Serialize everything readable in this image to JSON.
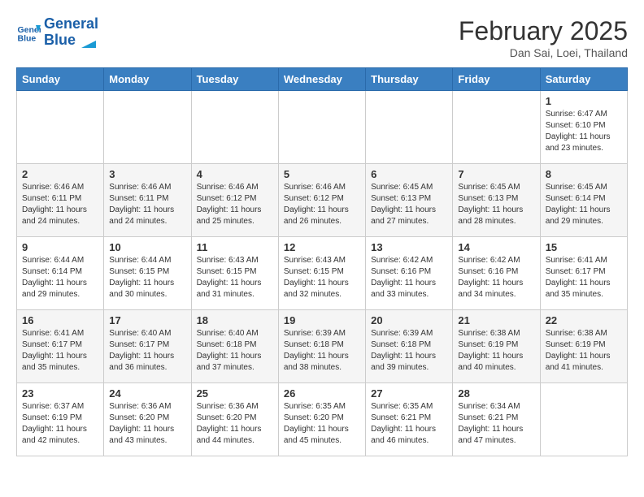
{
  "header": {
    "logo_line1": "General",
    "logo_line2": "Blue",
    "month": "February 2025",
    "location": "Dan Sai, Loei, Thailand"
  },
  "weekdays": [
    "Sunday",
    "Monday",
    "Tuesday",
    "Wednesday",
    "Thursday",
    "Friday",
    "Saturday"
  ],
  "weeks": [
    [
      {
        "day": "",
        "info": ""
      },
      {
        "day": "",
        "info": ""
      },
      {
        "day": "",
        "info": ""
      },
      {
        "day": "",
        "info": ""
      },
      {
        "day": "",
        "info": ""
      },
      {
        "day": "",
        "info": ""
      },
      {
        "day": "1",
        "info": "Sunrise: 6:47 AM\nSunset: 6:10 PM\nDaylight: 11 hours\nand 23 minutes."
      }
    ],
    [
      {
        "day": "2",
        "info": "Sunrise: 6:46 AM\nSunset: 6:11 PM\nDaylight: 11 hours\nand 24 minutes."
      },
      {
        "day": "3",
        "info": "Sunrise: 6:46 AM\nSunset: 6:11 PM\nDaylight: 11 hours\nand 24 minutes."
      },
      {
        "day": "4",
        "info": "Sunrise: 6:46 AM\nSunset: 6:12 PM\nDaylight: 11 hours\nand 25 minutes."
      },
      {
        "day": "5",
        "info": "Sunrise: 6:46 AM\nSunset: 6:12 PM\nDaylight: 11 hours\nand 26 minutes."
      },
      {
        "day": "6",
        "info": "Sunrise: 6:45 AM\nSunset: 6:13 PM\nDaylight: 11 hours\nand 27 minutes."
      },
      {
        "day": "7",
        "info": "Sunrise: 6:45 AM\nSunset: 6:13 PM\nDaylight: 11 hours\nand 28 minutes."
      },
      {
        "day": "8",
        "info": "Sunrise: 6:45 AM\nSunset: 6:14 PM\nDaylight: 11 hours\nand 29 minutes."
      }
    ],
    [
      {
        "day": "9",
        "info": "Sunrise: 6:44 AM\nSunset: 6:14 PM\nDaylight: 11 hours\nand 29 minutes."
      },
      {
        "day": "10",
        "info": "Sunrise: 6:44 AM\nSunset: 6:15 PM\nDaylight: 11 hours\nand 30 minutes."
      },
      {
        "day": "11",
        "info": "Sunrise: 6:43 AM\nSunset: 6:15 PM\nDaylight: 11 hours\nand 31 minutes."
      },
      {
        "day": "12",
        "info": "Sunrise: 6:43 AM\nSunset: 6:15 PM\nDaylight: 11 hours\nand 32 minutes."
      },
      {
        "day": "13",
        "info": "Sunrise: 6:42 AM\nSunset: 6:16 PM\nDaylight: 11 hours\nand 33 minutes."
      },
      {
        "day": "14",
        "info": "Sunrise: 6:42 AM\nSunset: 6:16 PM\nDaylight: 11 hours\nand 34 minutes."
      },
      {
        "day": "15",
        "info": "Sunrise: 6:41 AM\nSunset: 6:17 PM\nDaylight: 11 hours\nand 35 minutes."
      }
    ],
    [
      {
        "day": "16",
        "info": "Sunrise: 6:41 AM\nSunset: 6:17 PM\nDaylight: 11 hours\nand 35 minutes."
      },
      {
        "day": "17",
        "info": "Sunrise: 6:40 AM\nSunset: 6:17 PM\nDaylight: 11 hours\nand 36 minutes."
      },
      {
        "day": "18",
        "info": "Sunrise: 6:40 AM\nSunset: 6:18 PM\nDaylight: 11 hours\nand 37 minutes."
      },
      {
        "day": "19",
        "info": "Sunrise: 6:39 AM\nSunset: 6:18 PM\nDaylight: 11 hours\nand 38 minutes."
      },
      {
        "day": "20",
        "info": "Sunrise: 6:39 AM\nSunset: 6:18 PM\nDaylight: 11 hours\nand 39 minutes."
      },
      {
        "day": "21",
        "info": "Sunrise: 6:38 AM\nSunset: 6:19 PM\nDaylight: 11 hours\nand 40 minutes."
      },
      {
        "day": "22",
        "info": "Sunrise: 6:38 AM\nSunset: 6:19 PM\nDaylight: 11 hours\nand 41 minutes."
      }
    ],
    [
      {
        "day": "23",
        "info": "Sunrise: 6:37 AM\nSunset: 6:19 PM\nDaylight: 11 hours\nand 42 minutes."
      },
      {
        "day": "24",
        "info": "Sunrise: 6:36 AM\nSunset: 6:20 PM\nDaylight: 11 hours\nand 43 minutes."
      },
      {
        "day": "25",
        "info": "Sunrise: 6:36 AM\nSunset: 6:20 PM\nDaylight: 11 hours\nand 44 minutes."
      },
      {
        "day": "26",
        "info": "Sunrise: 6:35 AM\nSunset: 6:20 PM\nDaylight: 11 hours\nand 45 minutes."
      },
      {
        "day": "27",
        "info": "Sunrise: 6:35 AM\nSunset: 6:21 PM\nDaylight: 11 hours\nand 46 minutes."
      },
      {
        "day": "28",
        "info": "Sunrise: 6:34 AM\nSunset: 6:21 PM\nDaylight: 11 hours\nand 47 minutes."
      },
      {
        "day": "",
        "info": ""
      }
    ]
  ]
}
